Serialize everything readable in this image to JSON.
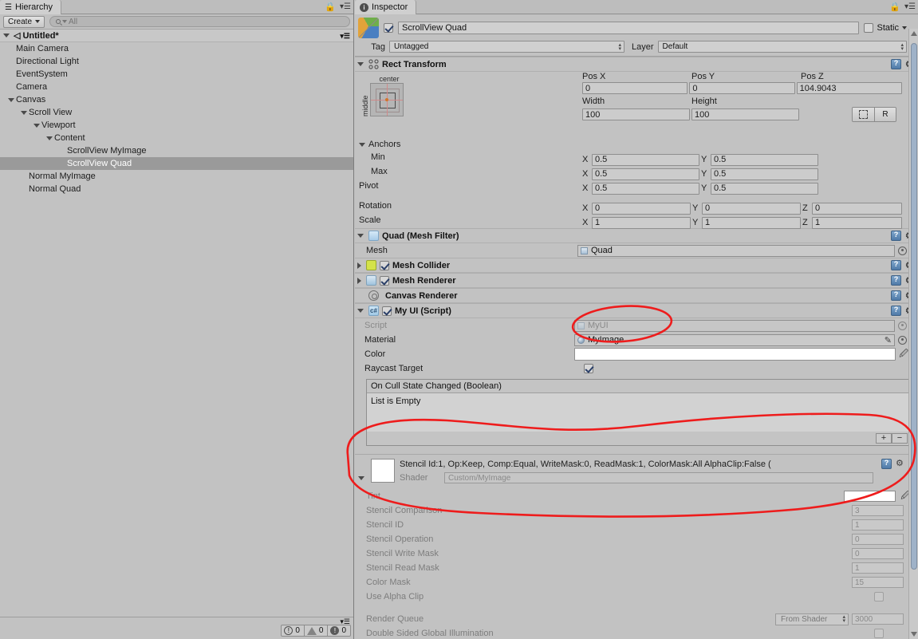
{
  "hierarchy": {
    "tab_label": "Hierarchy",
    "tab_icon": "hierarchy-icon",
    "create_label": "Create",
    "search_placeholder": "All",
    "scene_name": "Untitled*",
    "items": [
      {
        "label": "Main Camera",
        "depth": 1,
        "expander": "none",
        "selected": false
      },
      {
        "label": "Directional Light",
        "depth": 1,
        "expander": "none",
        "selected": false
      },
      {
        "label": "EventSystem",
        "depth": 1,
        "expander": "none",
        "selected": false
      },
      {
        "label": "Camera",
        "depth": 1,
        "expander": "none",
        "selected": false
      },
      {
        "label": "Canvas",
        "depth": 1,
        "expander": "expanded",
        "selected": false
      },
      {
        "label": "Scroll View",
        "depth": 2,
        "expander": "expanded",
        "selected": false
      },
      {
        "label": "Viewport",
        "depth": 3,
        "expander": "expanded",
        "selected": false
      },
      {
        "label": "Content",
        "depth": 4,
        "expander": "expanded",
        "selected": false
      },
      {
        "label": "ScrollView MyImage",
        "depth": 5,
        "expander": "none",
        "selected": false
      },
      {
        "label": "ScrollView Quad",
        "depth": 5,
        "expander": "none",
        "selected": true
      },
      {
        "label": "Normal MyImage",
        "depth": 2,
        "expander": "none",
        "selected": false
      },
      {
        "label": "Normal Quad",
        "depth": 2,
        "expander": "none",
        "selected": false
      }
    ],
    "status": {
      "errors": "0",
      "warnings": "0",
      "infos": "0"
    }
  },
  "inspector": {
    "tab_label": "Inspector",
    "tab_icon": "info-icon",
    "gameobject": {
      "enabled": true,
      "name": "ScrollView Quad",
      "static_label": "Static",
      "static_checked": false,
      "tag_label": "Tag",
      "tag_value": "Untagged",
      "layer_label": "Layer",
      "layer_value": "Default"
    },
    "rect_transform": {
      "title": "Rect Transform",
      "anchor_preset_top": "center",
      "anchor_preset_side": "middle",
      "pos_x_label": "Pos X",
      "pos_x": "0",
      "pos_y_label": "Pos Y",
      "pos_y": "0",
      "pos_z_label": "Pos Z",
      "pos_z": "104.9043",
      "width_label": "Width",
      "width": "100",
      "height_label": "Height",
      "height": "100",
      "blueprint_button": "blueprint-mode",
      "raw_button": "R",
      "anchors_label": "Anchors",
      "min_label": "Min",
      "min_x": "0.5",
      "min_y": "0.5",
      "max_label": "Max",
      "max_x": "0.5",
      "max_y": "0.5",
      "pivot_label": "Pivot",
      "pivot_x": "0.5",
      "pivot_y": "0.5",
      "rotation_label": "Rotation",
      "rot_x": "0",
      "rot_y": "0",
      "rot_z": "0",
      "scale_label": "Scale",
      "scale_x": "1",
      "scale_y": "1",
      "scale_z": "1"
    },
    "mesh_filter": {
      "title": "Quad (Mesh Filter)",
      "mesh_label": "Mesh",
      "mesh_value": "Quad"
    },
    "mesh_collider": {
      "title": "Mesh Collider",
      "enabled": true
    },
    "mesh_renderer": {
      "title": "Mesh Renderer",
      "enabled": true
    },
    "canvas_renderer": {
      "title": "Canvas Renderer"
    },
    "my_ui": {
      "title": "My UI (Script)",
      "enabled": true,
      "script_label": "Script",
      "script_value": "MyUI",
      "material_label": "Material",
      "material_value": "MyImage",
      "color_label": "Color",
      "color_value": "#FFFFFF",
      "raycast_label": "Raycast Target",
      "raycast_checked": true,
      "event_title": "On Cull State Changed (Boolean)",
      "event_empty": "List is Empty",
      "add_button": "+",
      "remove_button": "−"
    },
    "material": {
      "header": "Stencil Id:1, Op:Keep, Comp:Equal, WriteMask:0, ReadMask:1, ColorMask:All AlphaClip:False (",
      "shader_label": "Shader",
      "shader_value": "Custom/MyImage",
      "properties": [
        {
          "label": "Tint",
          "value": "",
          "kind": "color"
        },
        {
          "label": "Stencil Comparison",
          "value": "3",
          "kind": "number"
        },
        {
          "label": "Stencil ID",
          "value": "1",
          "kind": "number"
        },
        {
          "label": "Stencil Operation",
          "value": "0",
          "kind": "number"
        },
        {
          "label": "Stencil Write Mask",
          "value": "0",
          "kind": "number"
        },
        {
          "label": "Stencil Read Mask",
          "value": "1",
          "kind": "number"
        },
        {
          "label": "Color Mask",
          "value": "15",
          "kind": "number"
        },
        {
          "label": "Use Alpha Clip",
          "value": "",
          "kind": "checkbox"
        }
      ],
      "render_queue_label": "Render Queue",
      "render_queue_mode": "From Shader",
      "render_queue_value": "3000",
      "double_sided_label": "Double Sided Global Illumination",
      "double_sided_checked": false
    }
  },
  "annotations": {
    "color": "#ee1c1c",
    "shapes": [
      "ellipse-material-field",
      "ellipse-material-block"
    ]
  }
}
